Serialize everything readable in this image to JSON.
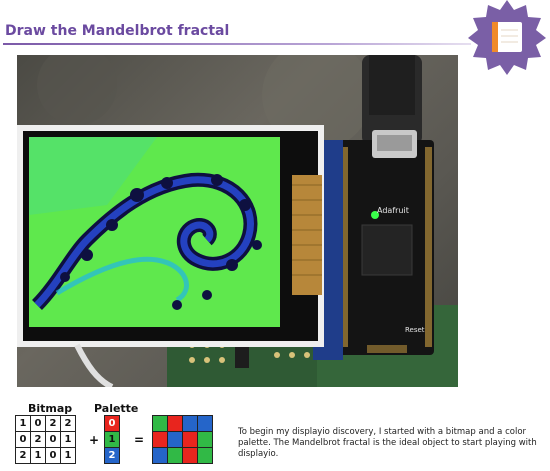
{
  "header": {
    "title": "Draw the Mandelbrot fractal"
  },
  "diagram": {
    "bitmap_label": "Bitmap",
    "palette_label": "Palette",
    "bitmap_rows": [
      [
        "1",
        "0",
        "2",
        "2"
      ],
      [
        "0",
        "2",
        "0",
        "1"
      ],
      [
        "2",
        "1",
        "0",
        "1"
      ]
    ],
    "palette_entries": [
      "0",
      "1",
      "2"
    ],
    "plus": "+",
    "equals": "=",
    "colors": {
      "0": "#e8251e",
      "1": "#31b946",
      "2": "#2565c9"
    }
  },
  "photo_board": {
    "board_label": "Adafruit",
    "button_label": "Reset"
  },
  "description": "To begin my displayio discovery, I started with a bitmap and a color palette. The Mandelbrot fractal is the ideal object to start playing with displayio."
}
